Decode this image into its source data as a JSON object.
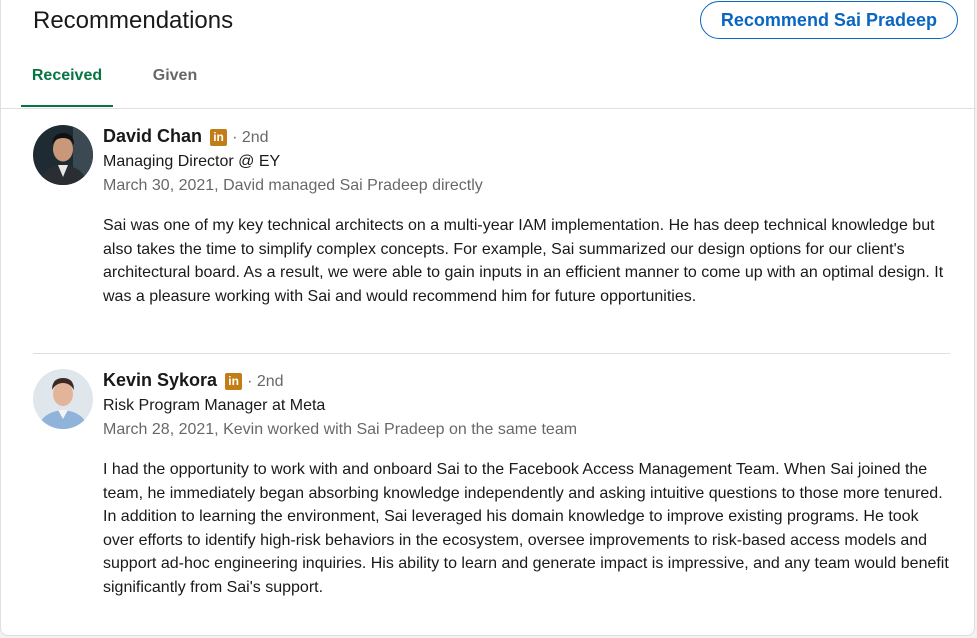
{
  "section": {
    "title": "Recommendations",
    "recommend_button": "Recommend Sai Pradeep"
  },
  "tabs": [
    {
      "label": "Received",
      "active": true
    },
    {
      "label": "Given",
      "active": false
    }
  ],
  "recommendations": [
    {
      "name": "David Chan",
      "badge": "in",
      "degree": "· 2nd",
      "headline": "Managing Director @ EY",
      "meta": "March 30, 2021, David managed Sai Pradeep directly",
      "text": "Sai was one of my key technical architects on a multi-year IAM implementation. He has deep technical knowledge but also takes the time to simplify complex concepts. For example, Sai summarized our design options for our client's architectural board. As a result, we were able to gain inputs in an efficient manner to come up with an optimal design. It was a pleasure working with Sai and would recommend him for future opportunities."
    },
    {
      "name": "Kevin Sykora",
      "badge": "in",
      "degree": "· 2nd",
      "headline": "Risk Program Manager at Meta",
      "meta": "March 28, 2021, Kevin worked with Sai Pradeep on the same team",
      "text": "I had the opportunity to work with and onboard Sai to the Facebook Access Management Team. When Sai joined the team, he immediately began absorbing knowledge independently and asking intuitive questions to those more tenured. In addition to learning the environment, Sai leveraged his domain knowledge to improve existing programs. He took over efforts to identify high-risk behaviors in the ecosystem, oversee improvements to risk-based access models and support ad-hoc engineering inquiries. His ability to learn and generate impact is impressive, and any team would benefit significantly from Sai's support."
    }
  ],
  "colors": {
    "accent": "#0a66c2",
    "active_tab": "#057642",
    "badge": "#c37d16"
  }
}
